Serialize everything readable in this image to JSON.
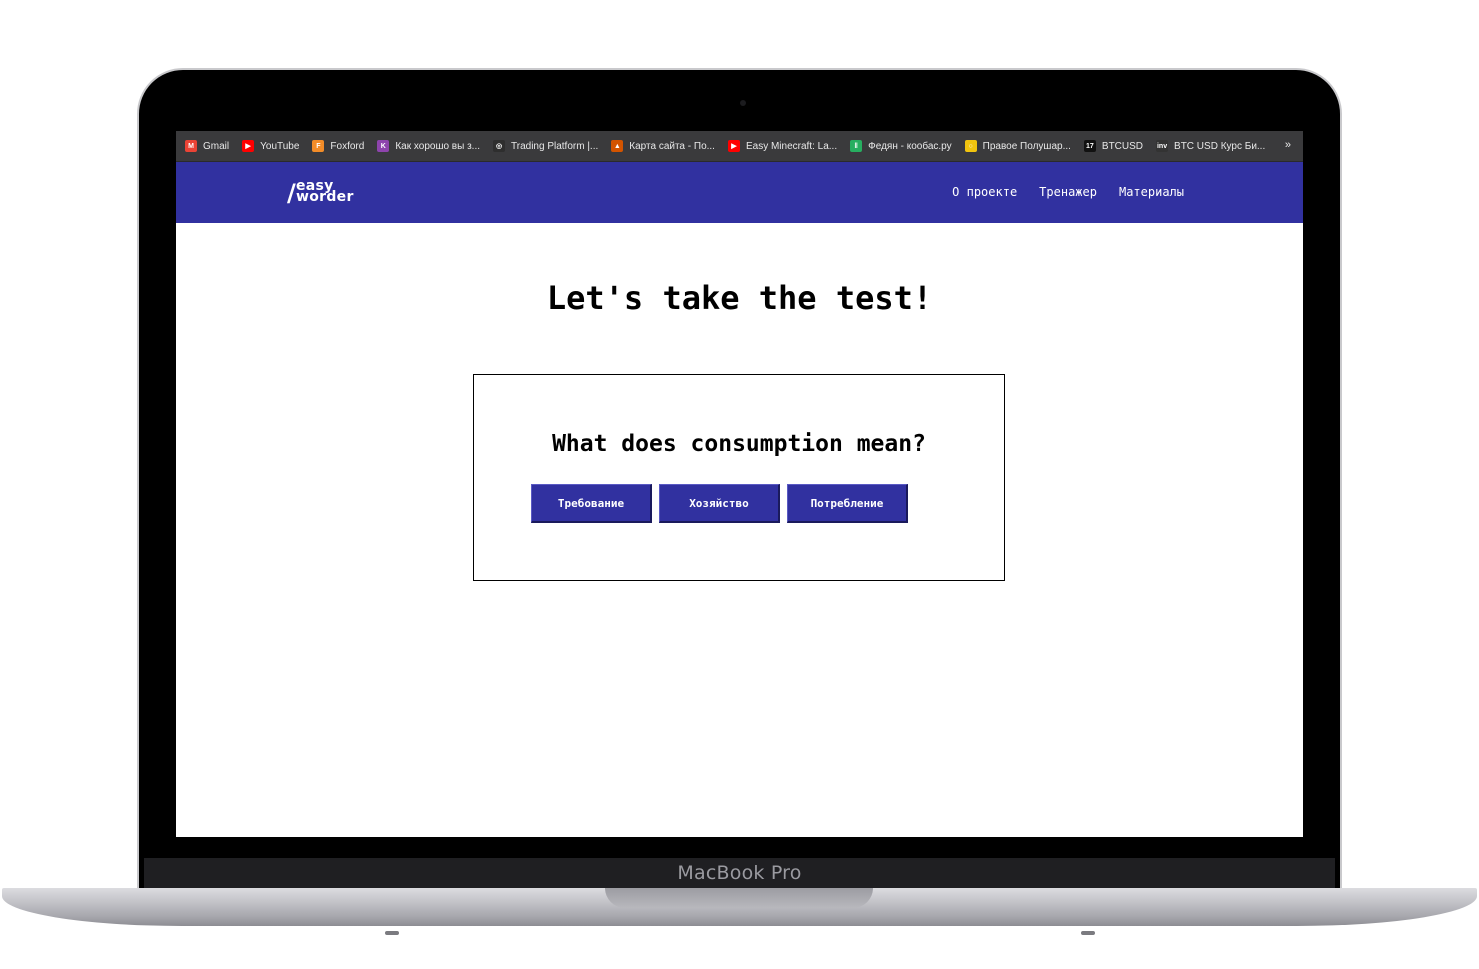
{
  "device": {
    "model_label": "MacBook Pro"
  },
  "bookmarks": [
    {
      "label": "Gmail",
      "icon": "gmail-icon",
      "color": "#ea4335",
      "glyph": "M"
    },
    {
      "label": "YouTube",
      "icon": "youtube-icon",
      "color": "#ff0000",
      "glyph": "▶"
    },
    {
      "label": "Foxford",
      "icon": "fox-icon",
      "color": "#f28c28",
      "glyph": "F"
    },
    {
      "label": "Как хорошо вы з...",
      "icon": "quiz-icon",
      "color": "#8e44ad",
      "glyph": "K"
    },
    {
      "label": "Trading Platform |...",
      "icon": "trading-icon",
      "color": "#2e2e2e",
      "glyph": "◎"
    },
    {
      "label": "Карта сайта - По...",
      "icon": "map-icon",
      "color": "#d35400",
      "glyph": "▲"
    },
    {
      "label": "Easy Minecraft: La...",
      "icon": "youtube-icon",
      "color": "#ff0000",
      "glyph": "▶"
    },
    {
      "label": "Федян - кообас.ру",
      "icon": "pause-icon",
      "color": "#27ae60",
      "glyph": "‖"
    },
    {
      "label": "Правое Полушар...",
      "icon": "ring-icon",
      "color": "#f1c40f",
      "glyph": "○"
    },
    {
      "label": "BTCUSD",
      "icon": "tradingview-icon",
      "color": "#111111",
      "glyph": "17"
    },
    {
      "label": "BTC USD Курс Би...",
      "icon": "investing-icon",
      "color": "#333333",
      "glyph": "inv"
    }
  ],
  "bookmarks_more": "»",
  "header": {
    "logo_line1": "easy",
    "logo_line2": "worder",
    "nav": [
      "О проекте",
      "Тренажер",
      "Материалы"
    ]
  },
  "main": {
    "title": "Let's take the test!",
    "question": "What does consumption mean?",
    "answers": [
      "Требование",
      "Хозяйство",
      "Потребление"
    ]
  },
  "colors": {
    "brand": "#3131a0",
    "bookmarks_bg": "#3a3a3c"
  }
}
